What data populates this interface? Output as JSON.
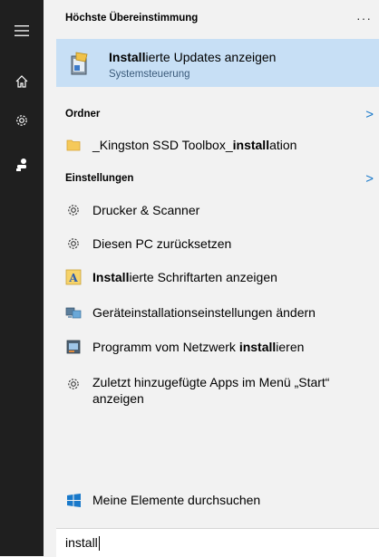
{
  "rail": {
    "icons": [
      "hamburger-icon",
      "home-icon",
      "settings-gear-icon",
      "user-icon"
    ]
  },
  "best_match": {
    "header": "Höchste Übereinstimmung",
    "more": "···",
    "item": {
      "title_bold": "Install",
      "title_rest": "ierte Updates anzeigen",
      "subtitle": "Systemsteuerung"
    }
  },
  "folders": {
    "header": "Ordner",
    "chevron": ">",
    "items": [
      {
        "pre": "_Kingston SSD Toolbox_",
        "bold": "install",
        "post": "ation"
      }
    ]
  },
  "settings": {
    "header": "Einstellungen",
    "chevron": ">",
    "items": [
      {
        "icon": "gear-icon",
        "pre": "Drucker & Scanner",
        "bold": "",
        "post": ""
      },
      {
        "icon": "gear-icon",
        "pre": "Diesen PC zurücksetzen",
        "bold": "",
        "post": ""
      },
      {
        "icon": "font-icon",
        "pre": "",
        "bold": "Install",
        "post": "ierte Schriftarten anzeigen"
      },
      {
        "icon": "device-install-icon",
        "pre": "Geräteinstallationseinstellungen ändern",
        "bold": "",
        "post": ""
      },
      {
        "icon": "network-program-icon",
        "pre": "Programm vom Netzwerk ",
        "bold": "install",
        "post": "ieren"
      },
      {
        "icon": "gear-icon",
        "pre": "Zuletzt hinzugefügte Apps im Menü „Start“ anzeigen",
        "bold": "",
        "post": ""
      }
    ]
  },
  "footer_action": {
    "label": "Meine Elemente durchsuchen",
    "icon": "windows-logo-icon"
  },
  "search": {
    "value": "install"
  },
  "colors": {
    "rail": "#1f1f1f",
    "highlight": "#c7dff5",
    "accent": "#1979ca",
    "panel": "#f2f2f2"
  }
}
